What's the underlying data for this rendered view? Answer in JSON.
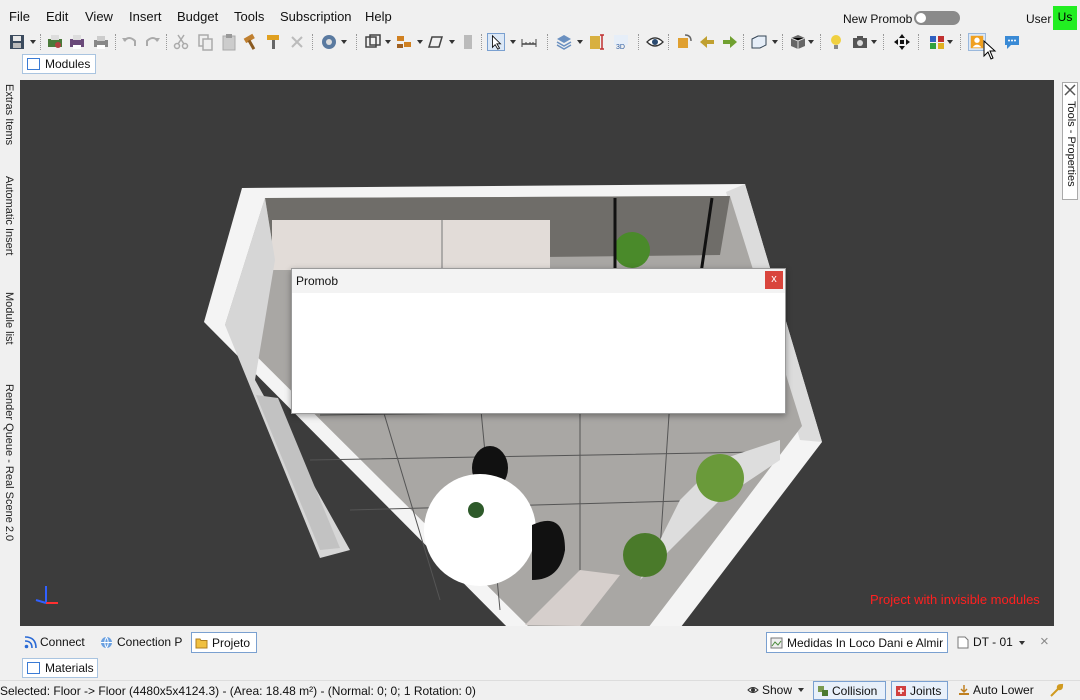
{
  "menu": {
    "items": [
      "File",
      "Edit",
      "View",
      "Insert",
      "Budget",
      "Tools",
      "Subscription",
      "Help"
    ],
    "new_promob_label": "New Promob",
    "new_promob_enabled": false,
    "user_label": "User",
    "user_badge": "Us"
  },
  "toolbar": {
    "icons": [
      "save-icon",
      "print-preview-icon",
      "print-icon",
      "print-setup-icon",
      "undo-icon",
      "redo-icon",
      "cut-icon",
      "copy-icon",
      "paste-icon",
      "hammer-icon",
      "format-painter-icon",
      "delete-icon",
      "render-settings-icon",
      "frame-icon",
      "group-icon",
      "shape-icon",
      "block-icon",
      "select-pointer-icon",
      "measure-icon",
      "layers-icon",
      "dimension-icon",
      "3d-view-icon",
      "eye-icon",
      "rotate-icon",
      "arrow-left-icon",
      "arrow-right-icon",
      "camera-view-icon",
      "box-icon",
      "light-icon",
      "photo-camera-icon",
      "move-icon",
      "palette-icon",
      "user-support-icon",
      "chat-icon"
    ]
  },
  "modules_tab": "Modules",
  "left_tabs": [
    "Extras Items",
    "Automatic Insert",
    "Module list",
    "Render Queue - Real Scene 2.0"
  ],
  "right_tab": "Tools - Properties",
  "viewport": {
    "invisible_message": "Project with invisible modules"
  },
  "dialog": {
    "title": "Promob",
    "close_label": "x"
  },
  "bottom_tabs": {
    "connect": "Connect",
    "conection_p": "Conection P",
    "projeto": "Projeto",
    "measures": "Medidas In Loco Dani e Almir",
    "dt": "DT - 01",
    "close": "×"
  },
  "materials_tab": "Materials",
  "status": {
    "selection_text": "Selected: Floor -> Floor (4480x5x4124.3) - (Area: 18.48 m²) - (Normal: 0; 0; 1 Rotation: 0)",
    "show": "Show",
    "collision": "Collision",
    "joints": "Joints",
    "auto_lower": "Auto Lower"
  },
  "colors": {
    "viewport_bg": "#3c3c3c",
    "accent": "#3a7bd5",
    "warning": "#ff2020",
    "user_badge": "#22ee22"
  }
}
